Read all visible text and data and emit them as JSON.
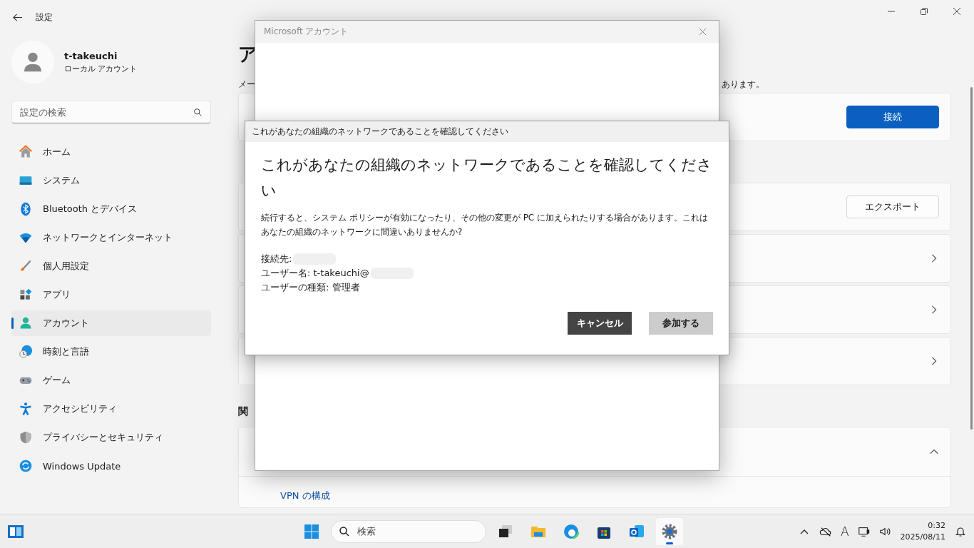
{
  "window": {
    "title": "設定"
  },
  "user": {
    "name": "t-takeuchi",
    "account_type": "ローカル アカウント"
  },
  "search": {
    "placeholder": "設定の検索"
  },
  "nav": [
    {
      "label": "ホーム",
      "selected": false
    },
    {
      "label": "システム",
      "selected": false
    },
    {
      "label": "Bluetooth とデバイス",
      "selected": false
    },
    {
      "label": "ネットワークとインターネット",
      "selected": false
    },
    {
      "label": "個人用設定",
      "selected": false
    },
    {
      "label": "アプリ",
      "selected": false
    },
    {
      "label": "アカウント",
      "selected": true
    },
    {
      "label": "時刻と言語",
      "selected": false
    },
    {
      "label": "ゲーム",
      "selected": false
    },
    {
      "label": "アクセシビリティ",
      "selected": false
    },
    {
      "label": "プライバシーとセキュリティ",
      "selected": false
    },
    {
      "label": "Windows Update",
      "selected": false
    }
  ],
  "page": {
    "heading": "ア",
    "note_left": "メー",
    "note_right": "あります。"
  },
  "sections": [
    {
      "cards": [
        {
          "kind": "button",
          "button": {
            "label": "接続",
            "primary": true
          }
        }
      ]
    },
    {
      "cards": [
        {
          "kind": "button",
          "button": {
            "label": "エクスポート",
            "primary": false
          }
        },
        {
          "kind": "link"
        },
        {
          "kind": "link"
        },
        {
          "kind": "link"
        }
      ]
    },
    {
      "heading": "関",
      "cards": [
        {
          "kind": "expander",
          "expanded": true,
          "links": [
            "VPN の構成"
          ]
        }
      ]
    }
  ],
  "account_window": {
    "title": "Microsoft アカウント"
  },
  "confirm_dialog": {
    "title": "これがあなたの組織のネットワークであることを確認してください",
    "heading": "これがあなたの組織のネットワークであることを確認してください",
    "body": "続行すると、システム ポリシーが有効になったり、その他の変更が PC に加えられたりする場合があります。これはあなたの組織のネットワークに間違いありませんか?",
    "details": [
      {
        "text": "接続先:",
        "redacted": true
      },
      {
        "text": "ユーザー名: t-takeuchi@",
        "redacted": true
      },
      {
        "text": "ユーザーの種類: 管理者",
        "redacted": false
      }
    ],
    "buttons": [
      {
        "label": "キャンセル",
        "kind": "dark"
      },
      {
        "label": "参加する",
        "kind": "light"
      }
    ]
  },
  "taskbar": {
    "search_placeholder": "検索",
    "apps": [
      {
        "active": false
      },
      {
        "active": false
      },
      {
        "active": false
      },
      {
        "active": false
      },
      {
        "active": false
      },
      {
        "active": true
      }
    ],
    "ime": "A",
    "time": "0:32",
    "date": "2025/08/11"
  }
}
